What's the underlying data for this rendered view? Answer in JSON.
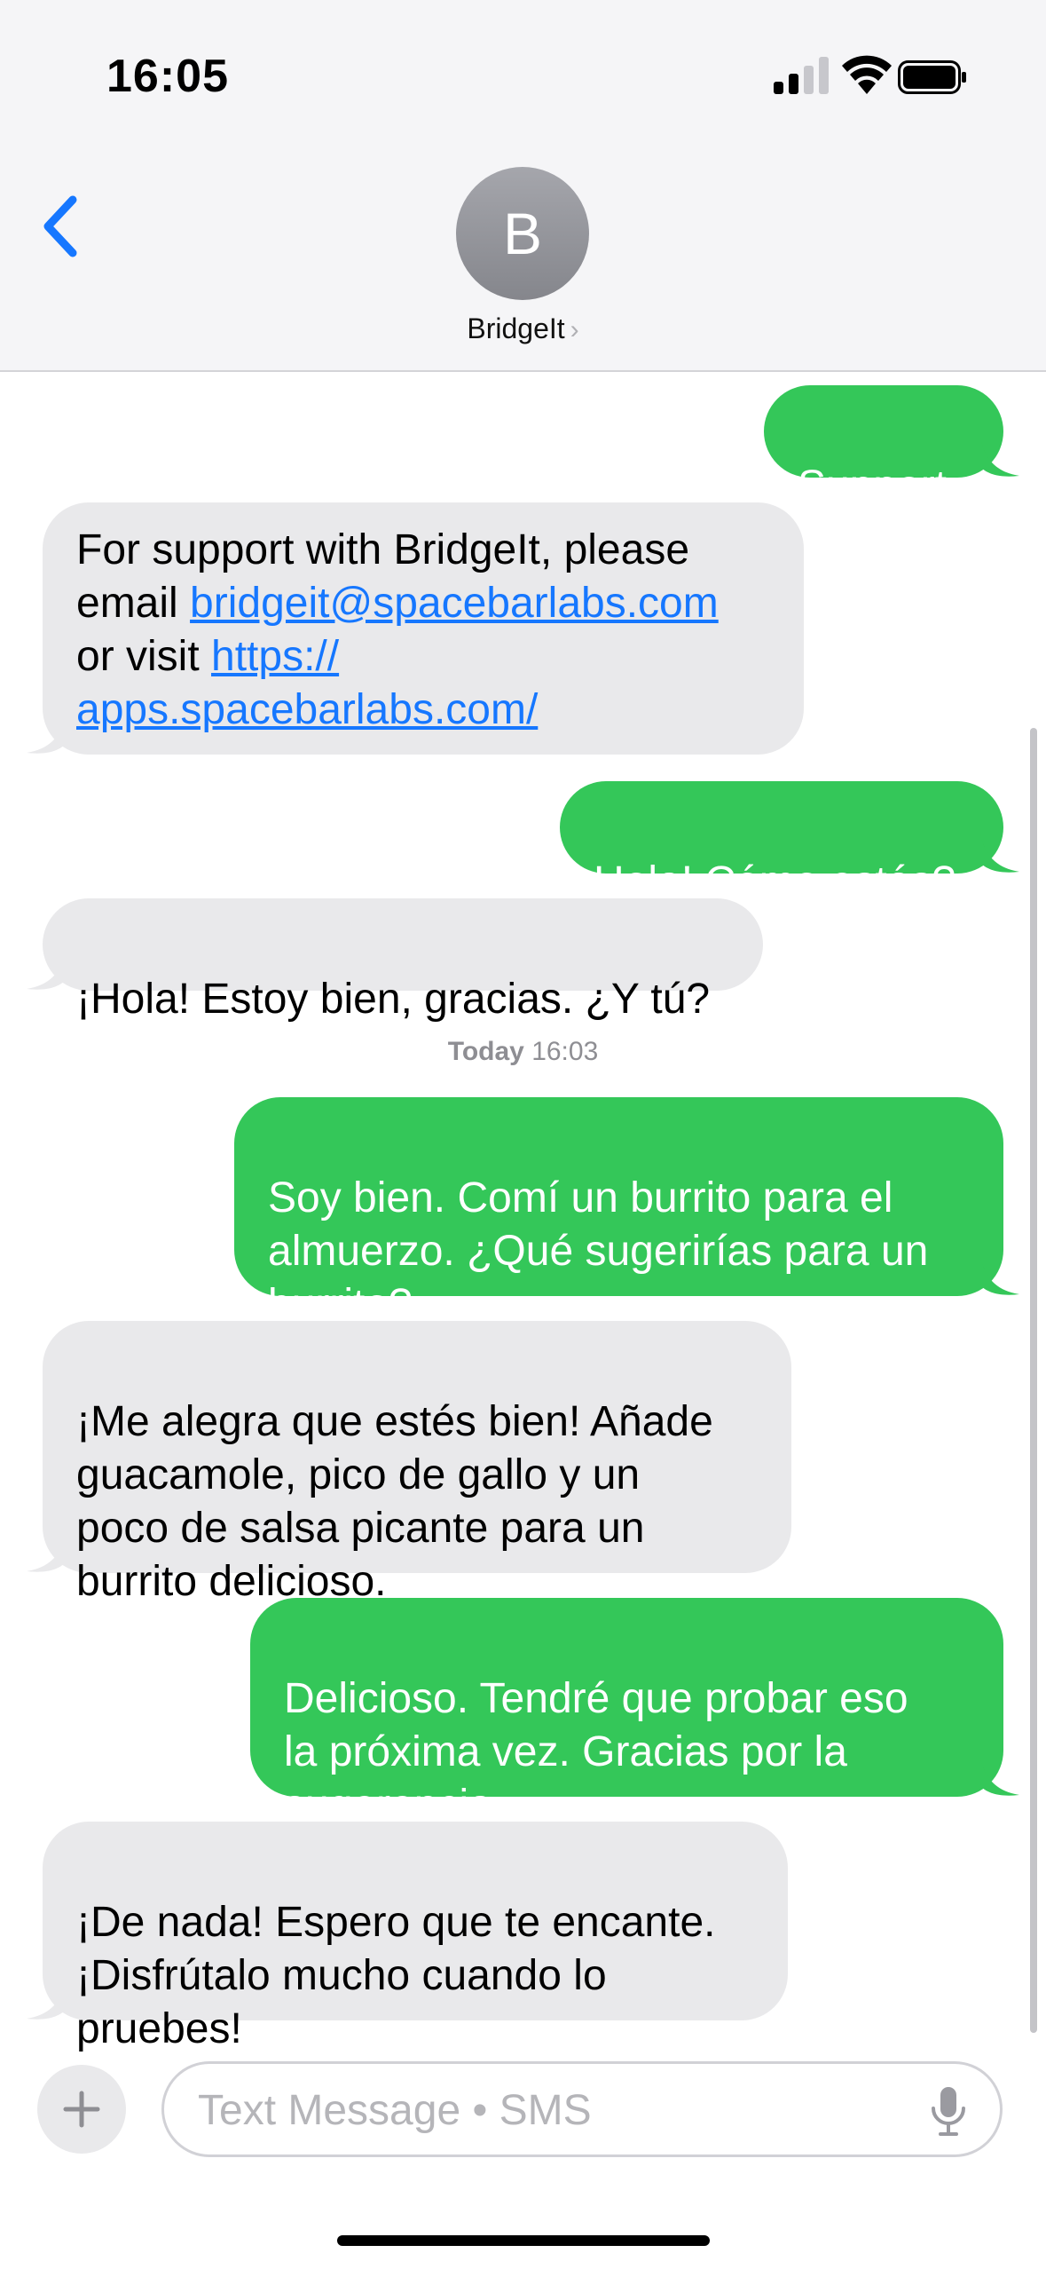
{
  "status_bar": {
    "time": "16:05"
  },
  "header": {
    "avatar_initial": "B",
    "contact_name": "BridgeIt"
  },
  "messages": [
    {
      "from": "me",
      "text": "Support"
    },
    {
      "from": "them",
      "text_before": "For support with BridgeIt, please email ",
      "link1": "bridgeit@spacebarlabs.com",
      "text_middle": " or visit ",
      "link2_a": "https://",
      "link2_b": "apps.spacebarlabs.com/"
    },
    {
      "from": "me",
      "text": "Hola! Cómo estás?"
    },
    {
      "from": "them",
      "text": "¡Hola! Estoy bien, gracias. ¿Y tú?"
    },
    {
      "from": "me",
      "text": "Soy bien.  Comí un burrito para el\nalmuerzo.  ¿Qué sugerirías para un\nburrito?"
    },
    {
      "from": "them",
      "text": "¡Me alegra que estés bien! Añade\nguacamole, pico de gallo y un\npoco de salsa picante para un\nburrito delicioso."
    },
    {
      "from": "me",
      "text": "Delicioso.  Tendré que probar eso\nla próxima vez.  Gracias por la\nsugerencia."
    },
    {
      "from": "them",
      "text": "¡De nada! Espero que te encante.\n¡Disfrútalo mucho cuando lo\npruebes!"
    }
  ],
  "timestamp": {
    "day": "Today",
    "time": "16:03"
  },
  "composer": {
    "placeholder": "Text Message • SMS"
  },
  "icons": {
    "back": "chevron-left-icon",
    "signal": "cellular-signal-icon",
    "wifi": "wifi-icon",
    "battery": "battery-icon",
    "add": "plus-icon",
    "mic": "microphone-icon"
  },
  "colors": {
    "outgoing": "#34c759",
    "incoming": "#e9e9eb",
    "accent": "#1677ff"
  }
}
